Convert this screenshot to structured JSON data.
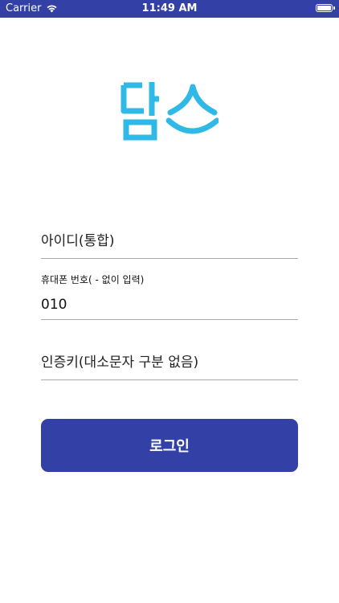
{
  "status_bar": {
    "carrier": "Carrier",
    "time": "11:49 AM",
    "background_color": "#3340a6",
    "icons": [
      "wifi-icon",
      "battery-icon"
    ]
  },
  "logo": {
    "text": "담스",
    "color": "#2fb9e6"
  },
  "form": {
    "id_field": {
      "placeholder": "아이디(통합)"
    },
    "phone_field": {
      "caption": "휴대폰 번호( - 없이 입력)",
      "value": "010"
    },
    "auth_key_field": {
      "placeholder": "인증키(대소문자 구분 없음)"
    }
  },
  "login_button": {
    "label": "로그인",
    "color": "#3340a6"
  }
}
